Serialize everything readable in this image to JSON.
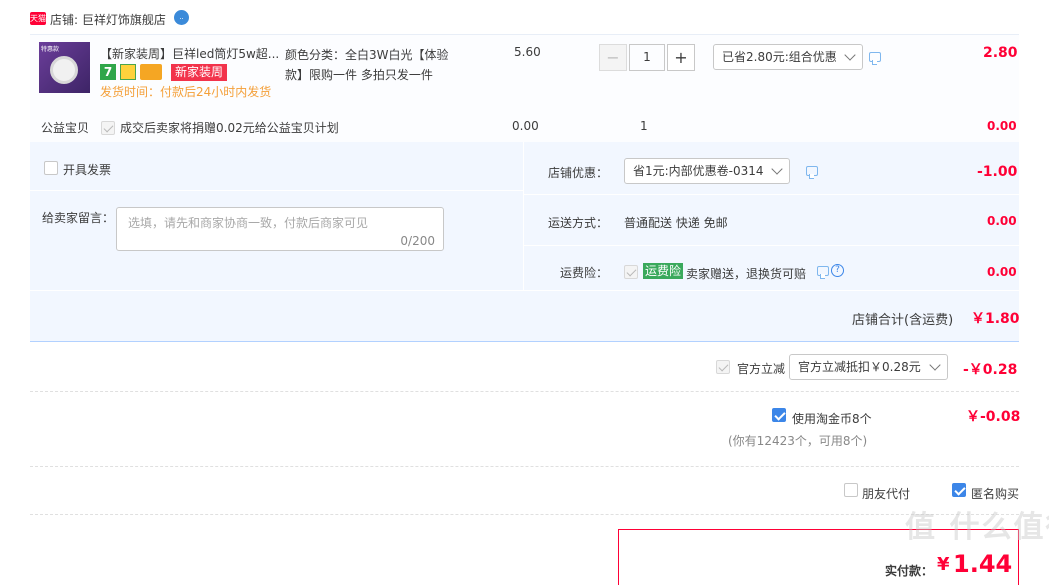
{
  "shop": {
    "badge": "天猫",
    "label": "店铺: 巨祥灯饰旗舰店"
  },
  "item": {
    "thumb_caption": "特惠款",
    "title": "【新家装周】巨祥led筒灯5w超...",
    "tag_seven": "7",
    "promo_tag": "新家装周",
    "ship_time": "发货时间：付款后24小时内发货",
    "spec": "颜色分类：全白3W白光【体验款】限购一件 多拍只发一件",
    "unit_price": "5.60",
    "qty_minus": "−",
    "qty": "1",
    "qty_plus": "+",
    "discount_select": "已省2.80元:组合优惠",
    "subtotal": "2.80"
  },
  "charity": {
    "label": "公益宝贝",
    "text": "成交后卖家将捐赠0.02元给公益宝贝计划",
    "price": "0.00",
    "qty": "1",
    "subtotal": "0.00"
  },
  "invoice_label": "开具发票",
  "message": {
    "label": "给卖家留言：",
    "placeholder": "选填，请先和商家协商一致，付款后商家可见",
    "counter": "0/200"
  },
  "shop_discount": {
    "label": "店铺优惠：",
    "select": "省1元:内部优惠卷-0314",
    "value": "-1.00"
  },
  "shipping": {
    "label": "运送方式：",
    "text": "普通配送 快递 免邮",
    "value": "0.00"
  },
  "insurance": {
    "label": "运费险：",
    "tag": "运费险",
    "text": "卖家赠送，退换货可赔",
    "value": "0.00"
  },
  "shop_total": {
    "label": "店铺合计(含运费)",
    "value": "￥1.80"
  },
  "official": {
    "label": "官方立减",
    "select": "官方立减抵扣￥0.28元",
    "value": "-￥0.28"
  },
  "coins": {
    "label": "使用淘金币8个",
    "note": "(你有12423个，可用8个)",
    "value": "￥-0.08"
  },
  "friend_pay": "朋友代付",
  "anonymous": "匿名购买",
  "pay": {
    "label": "实付款：",
    "value": "1.44"
  },
  "watermark": "值 什么值得买",
  "colors": {
    "accent": "#ff0036",
    "panel": "#f2f7ff",
    "border_blue": "#b2d1ff",
    "check_blue": "#3c86e8",
    "tag_green": "#3aa95c"
  }
}
